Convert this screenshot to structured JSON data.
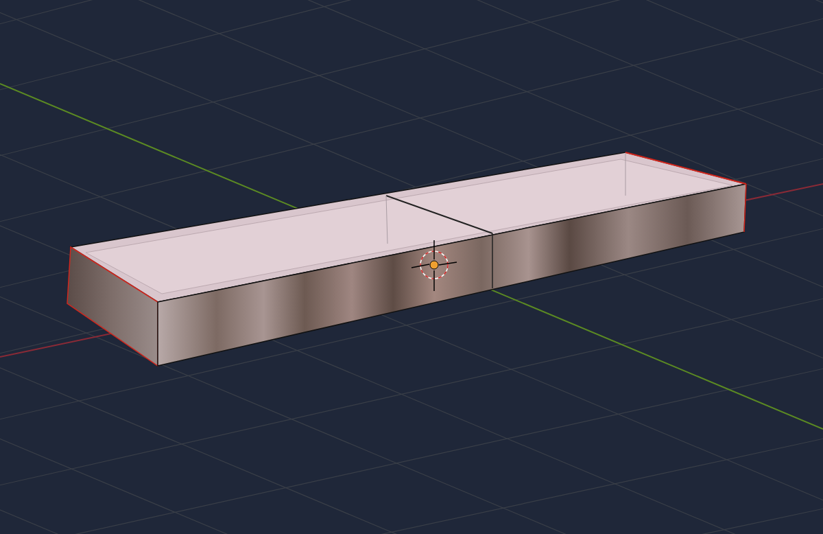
{
  "viewport": {
    "show_grid": true
  }
}
